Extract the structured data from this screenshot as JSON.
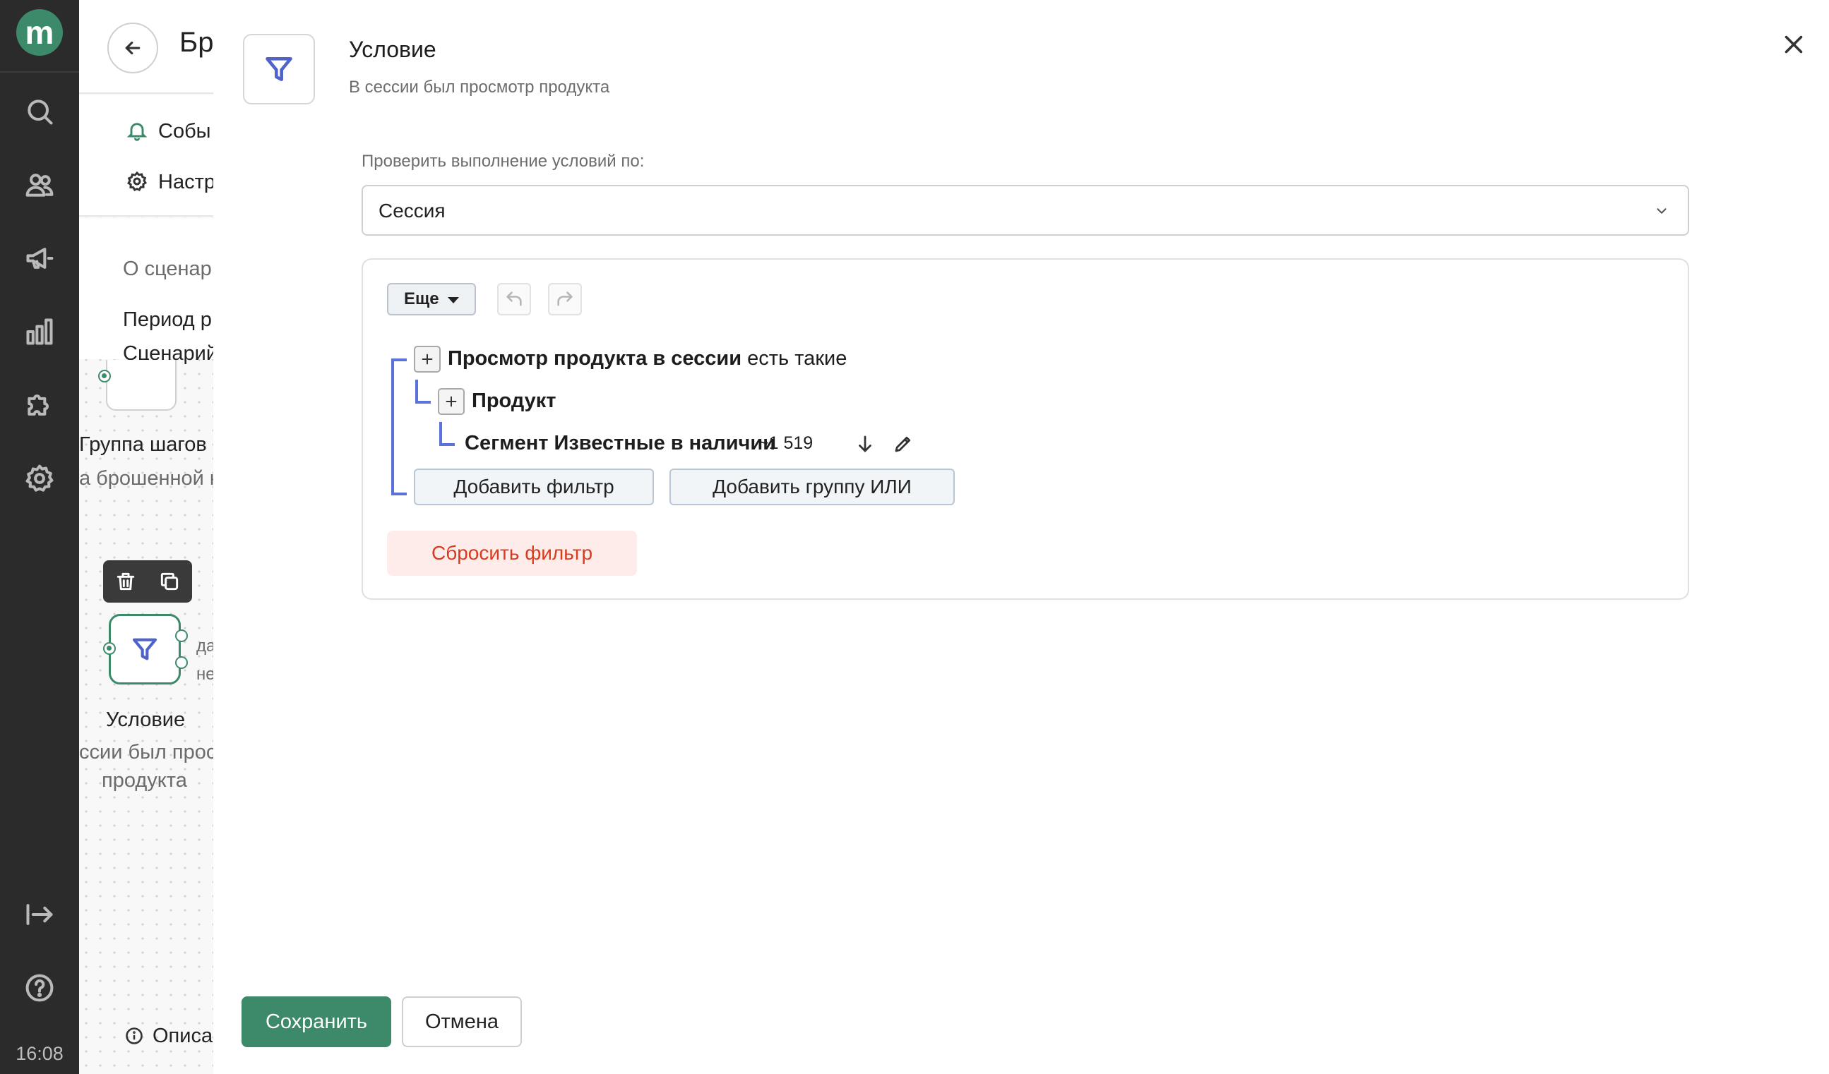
{
  "rail": {
    "logo_letter": "m",
    "icons": [
      "search-icon",
      "users-icon",
      "megaphone-icon",
      "bar-chart-icon",
      "puzzle-icon",
      "gear-icon",
      "collapse-icon",
      "help-icon"
    ],
    "time": "16:08"
  },
  "background": {
    "page_title_fragment": "Бр",
    "tabs": [
      {
        "label": "Собы",
        "icon": "bell-icon"
      },
      {
        "label": "Настр",
        "icon": "gear-icon"
      }
    ],
    "info": {
      "about": "О сценар",
      "period": "Период р",
      "scenario": "Сценарий"
    },
    "step_group": {
      "title": "Группа шагов",
      "subtitle": "а брошенной к"
    },
    "condition_node": {
      "title": "Условие",
      "subtitle_line1": "ссии был прос",
      "subtitle_line2": "продукта",
      "branch_yes": "да",
      "branch_no": "не"
    },
    "description_fragment": "Описа"
  },
  "modal": {
    "icon": "filter-icon",
    "title": "Условие",
    "subtitle": "В сессии был просмотр продукта",
    "check_label": "Проверить выполнение условий по:",
    "check_value": "Сессия",
    "more_label": "Еще",
    "filter": {
      "row1_bold": "Просмотр продукта в сессии",
      "row1_rest": " есть такие",
      "row2_bold": "Продукт",
      "row3_bold": "Сегмент Известные в наличии",
      "row3_count": "~1 519",
      "add_filter": "Добавить фильтр",
      "add_or_group": "Добавить группу ИЛИ",
      "reset": "Сбросить фильтр"
    }
  },
  "footer": {
    "save": "Сохранить",
    "cancel": "Отмена"
  },
  "colors": {
    "accent_green": "#3d8a6a",
    "tree_blue": "#5b72d8",
    "reset_red": "#d93b1c",
    "rail_dark": "#2b2b2b"
  }
}
